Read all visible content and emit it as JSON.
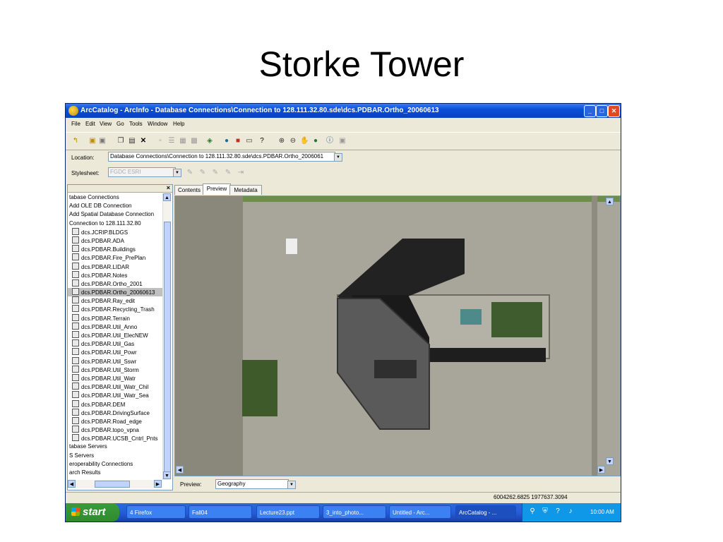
{
  "slide": {
    "title": "Storke Tower"
  },
  "window": {
    "title": "ArcCatalog - ArcInfo - Database Connections\\Connection to 128.111.32.80.sde\\dcs.PDBAR.Ortho_20060613",
    "minimize": "_",
    "maximize": "□",
    "close": "✕"
  },
  "menu": [
    "File",
    "Edit",
    "View",
    "Go",
    "Tools",
    "Window",
    "Help"
  ],
  "toolbar": {
    "icons": [
      "up-one-level-icon",
      "connect-folder-icon",
      "disconnect-folder-icon",
      "copy-icon",
      "paste-icon",
      "delete-icon",
      "large-icons-icon",
      "list-icon",
      "details-icon",
      "thumbnails-icon",
      "launch-arcmap-icon",
      "search-icon",
      "arctoolbox-icon",
      "command-line-icon",
      "whats-this-icon",
      "zoom-in-icon",
      "zoom-out-icon",
      "pan-icon",
      "full-extent-icon",
      "identify-icon",
      "create-thumbnail-icon"
    ]
  },
  "location": {
    "label": "Location:",
    "value": "Database Connections\\Connection to 128.111.32.80.sde\\dcs.PDBAR.Ortho_2006061"
  },
  "stylesheet": {
    "label": "Stylesheet:",
    "value": "FGDC ESRI"
  },
  "tree": {
    "close": "×",
    "items": [
      {
        "label": "tabase Connections",
        "icon": false
      },
      {
        "label": "Add OLE DB Connection",
        "icon": false
      },
      {
        "label": "Add Spatial Database Connection",
        "icon": false
      },
      {
        "label": "Connection to 128.111.32.80",
        "icon": false
      },
      {
        "label": "dcs.JCRIP.BLDGS",
        "icon": true
      },
      {
        "label": "dcs.PDBAR.ADA",
        "icon": true
      },
      {
        "label": "dcs.PDBAR.Buildings",
        "icon": true
      },
      {
        "label": "dcs.PDBAR.Fire_PrePlan",
        "icon": true
      },
      {
        "label": "dcs.PDBAR.LIDAR",
        "icon": true
      },
      {
        "label": "dcs.PDBAR.Notes",
        "icon": true
      },
      {
        "label": "dcs.PDBAR.Ortho_2001",
        "icon": true
      },
      {
        "label": "dcs.PDBAR.Ortho_20060613",
        "icon": true,
        "selected": true
      },
      {
        "label": "dcs.PDBAR.Ray_edit",
        "icon": true
      },
      {
        "label": "dcs.PDBAR.Recycling_Trash",
        "icon": true
      },
      {
        "label": "dcs.PDBAR.Terrain",
        "icon": true
      },
      {
        "label": "dcs.PDBAR.Util_Anno",
        "icon": true
      },
      {
        "label": "dcs.PDBAR.Util_ElecNEW",
        "icon": true
      },
      {
        "label": "dcs.PDBAR.Util_Gas",
        "icon": true
      },
      {
        "label": "dcs.PDBAR.Util_Powr",
        "icon": true
      },
      {
        "label": "dcs.PDBAR.Util_Sswr",
        "icon": true
      },
      {
        "label": "dcs.PDBAR.Util_Storm",
        "icon": true
      },
      {
        "label": "dcs.PDBAR.Util_Watr",
        "icon": true
      },
      {
        "label": "dcs.PDBAR.Util_Watr_Chil",
        "icon": true
      },
      {
        "label": "dcs.PDBAR.Util_Watr_Sea",
        "icon": true
      },
      {
        "label": "dcs.PDBAR.DEM",
        "icon": true
      },
      {
        "label": "dcs.PDBAR.DrivingSurface",
        "icon": true
      },
      {
        "label": "dcs.PDBAR.Road_edge",
        "icon": true
      },
      {
        "label": "dcs.PDBAR.topo_vpna",
        "icon": true
      },
      {
        "label": "dcs.PDBAR.UCSB_Cntrl_Pnts",
        "icon": true
      },
      {
        "label": "tabase Servers",
        "icon": false
      },
      {
        "label": "S Servers",
        "icon": false
      },
      {
        "label": "eroperability Connections",
        "icon": false
      },
      {
        "label": "arch Results",
        "icon": false
      }
    ]
  },
  "tabs": [
    "Contents",
    "Preview",
    "Metadata"
  ],
  "preview": {
    "label": "Preview:",
    "value": "Geography"
  },
  "status": {
    "coords": "6004262.6825  1977637.3094"
  },
  "taskbar": {
    "start": "start",
    "tasks": [
      "4 Firefox",
      "Fall04",
      "Lecture23.ppt",
      "3_into_photo...",
      "Untitled - Arc...",
      "ArcCatalog - ..."
    ],
    "clock": "10:00 AM"
  }
}
